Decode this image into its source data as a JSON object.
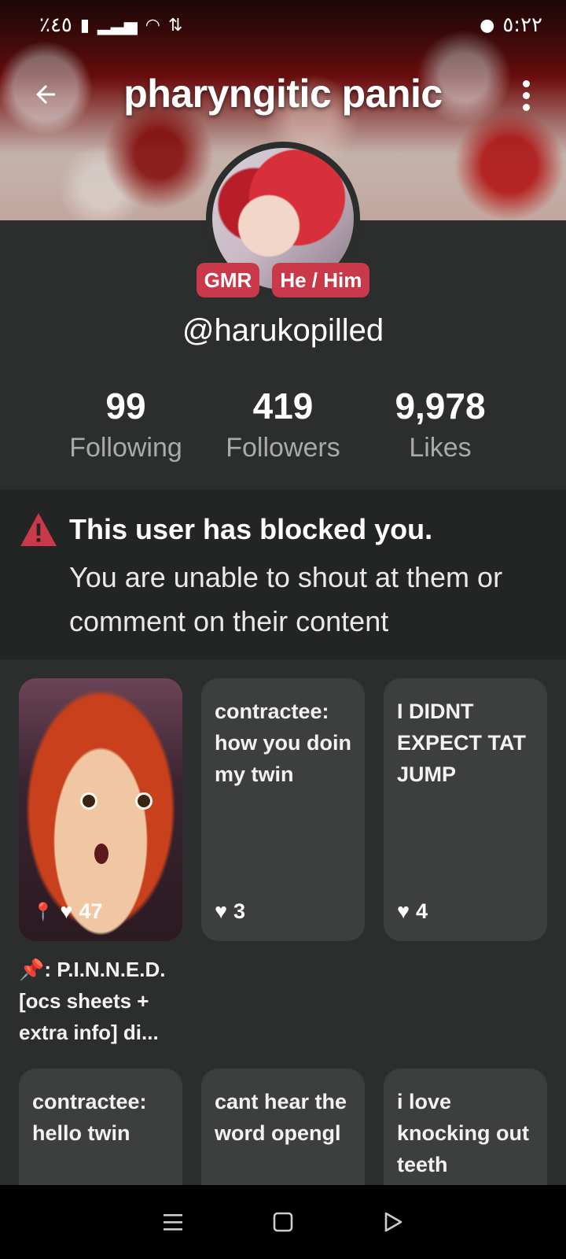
{
  "status_bar": {
    "battery_text": "٪٤٥",
    "time": "٥:٢٢"
  },
  "header": {
    "title": "pharyngitic panic"
  },
  "profile": {
    "badges": [
      "GMR",
      "He / Him"
    ],
    "handle": "@harukopilled"
  },
  "stats": [
    {
      "value": "99",
      "label": "Following"
    },
    {
      "value": "419",
      "label": "Followers"
    },
    {
      "value": "9,978",
      "label": "Likes"
    }
  ],
  "blocked_notice": {
    "title": "This user has blocked you.",
    "body": "You are unable to shout at them or comment on their content"
  },
  "posts": [
    {
      "text": "",
      "likes": "47",
      "pinned": true,
      "caption": "📌: P.I.N.N.E.D. [ocs sheets + extra info] di..."
    },
    {
      "text": "contractee: how you doin my twin",
      "likes": "3"
    },
    {
      "text": "I DIDNT EXPECT TAT JUMP",
      "likes": "4"
    },
    {
      "text": "contractee: hello twin"
    },
    {
      "text": "cant hear the word opengl"
    },
    {
      "text": "i love knocking out teeth"
    }
  ],
  "colors": {
    "accent": "#c9394a",
    "background": "#2c2d2d",
    "notice_bg": "#232424",
    "card_bg": "#3d3e3e"
  }
}
